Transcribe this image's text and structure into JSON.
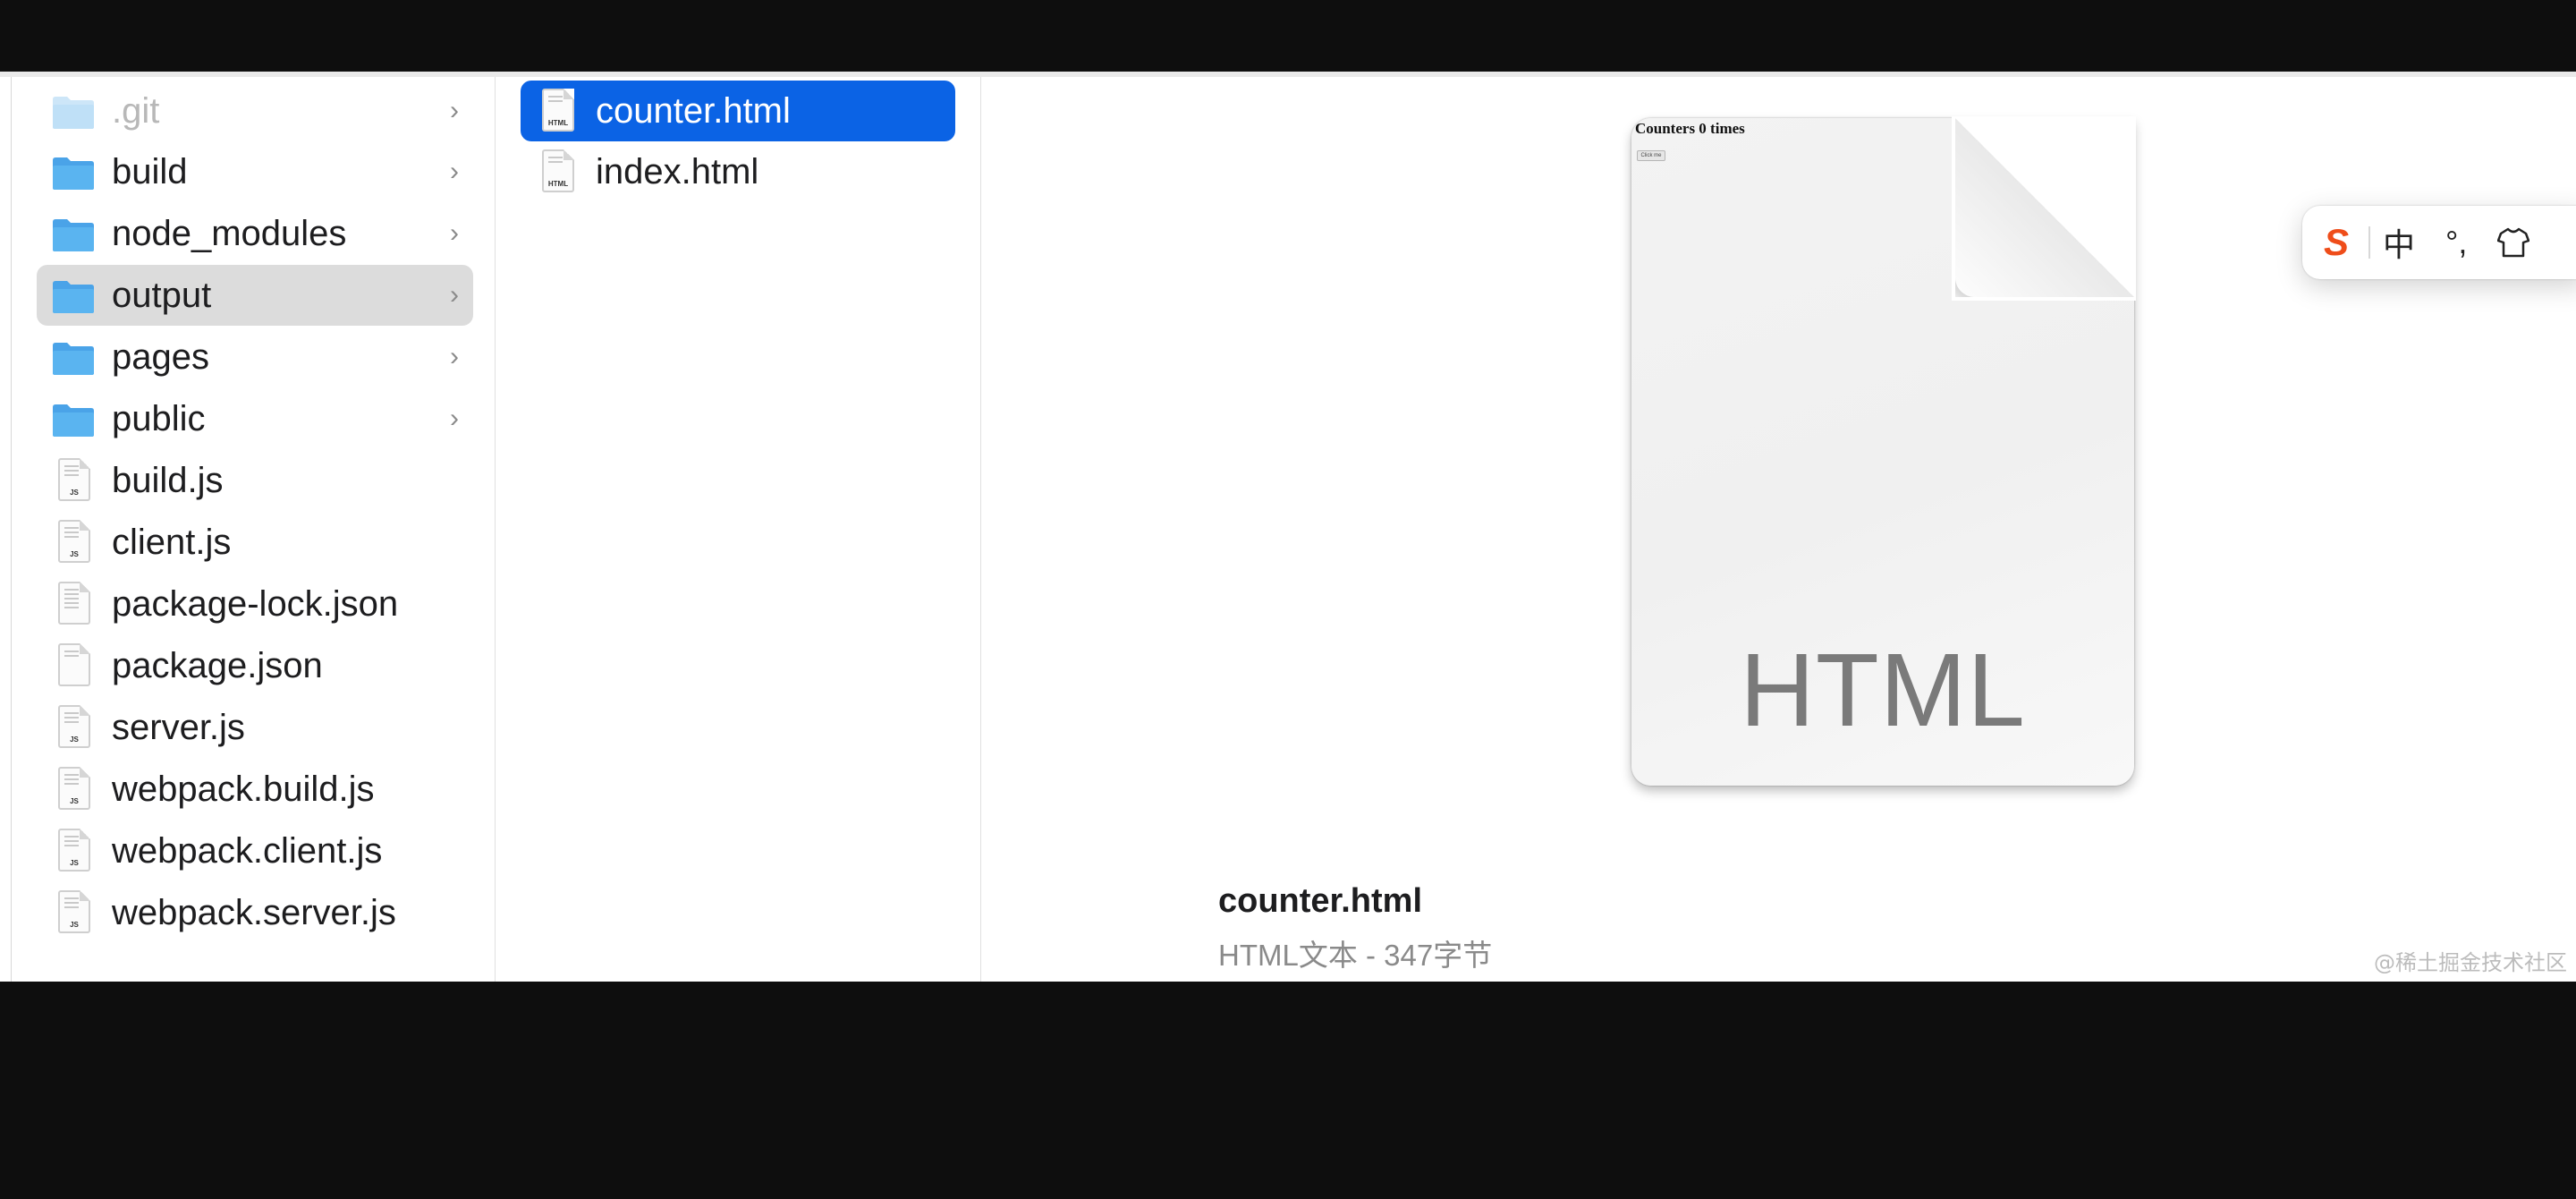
{
  "sidebar": {
    "items": [
      {
        "label": ".git",
        "kind": "folder",
        "chevron": "›"
      },
      {
        "label": "build",
        "kind": "folder",
        "chevron": "›"
      },
      {
        "label": "node_modules",
        "kind": "folder",
        "chevron": "›"
      },
      {
        "label": "output",
        "kind": "folder",
        "chevron": "›"
      },
      {
        "label": "pages",
        "kind": "folder",
        "chevron": "›"
      },
      {
        "label": "public",
        "kind": "folder",
        "chevron": "›"
      },
      {
        "label": "build.js",
        "kind": "file",
        "tag": "JS"
      },
      {
        "label": "client.js",
        "kind": "file",
        "tag": "JS"
      },
      {
        "label": "package-lock.json",
        "kind": "file",
        "tag": ""
      },
      {
        "label": "package.json",
        "kind": "file",
        "tag": ""
      },
      {
        "label": "server.js",
        "kind": "file",
        "tag": "JS"
      },
      {
        "label": "webpack.build.js",
        "kind": "file",
        "tag": "JS"
      },
      {
        "label": "webpack.client.js",
        "kind": "file",
        "tag": "JS"
      },
      {
        "label": "webpack.server.js",
        "kind": "file",
        "tag": "JS"
      }
    ]
  },
  "files": {
    "items": [
      {
        "label": "counter.html",
        "tag": "HTML"
      },
      {
        "label": "index.html",
        "tag": "HTML"
      }
    ]
  },
  "preview": {
    "doc_title": "Counters 0 times",
    "doc_button": "Click me",
    "kind_label": "HTML",
    "filename": "counter.html",
    "meta": "HTML文本 - 347字节"
  },
  "ime": {
    "logo": "S",
    "mode": "中",
    "punct": "°,"
  },
  "watermark": "@稀土掘金技术社区",
  "colors": {
    "selection_blue": "#0b63e5",
    "folder_blue": "#5ab4f0",
    "ime_logo": "#ef4d1a"
  },
  "icons": {
    "folder": "folder-icon",
    "file": "document-icon",
    "chevron": "chevron-right-icon",
    "skin": "shirt-icon"
  }
}
